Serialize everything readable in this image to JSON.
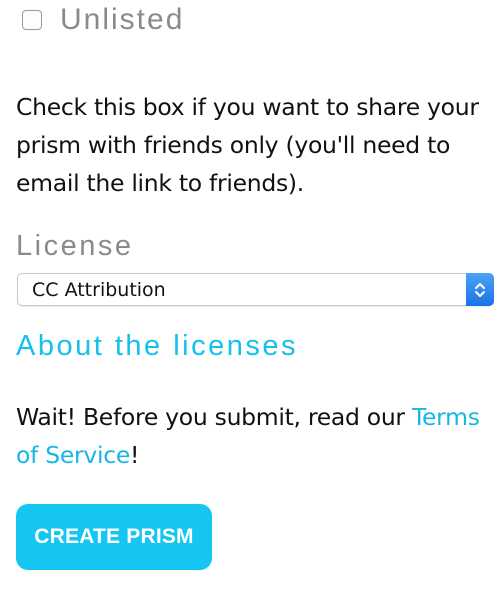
{
  "unlisted": {
    "label": "Unlisted",
    "checked": false
  },
  "help_text": "Check this box if you want to share your prism with friends only (you'll need to email the link to friends).",
  "license": {
    "label": "License",
    "selected": "CC Attribution"
  },
  "about_link": "About the licenses",
  "terms": {
    "prefix": "Wait! Before you submit, read our ",
    "link": "Terms of Service",
    "suffix": "!"
  },
  "submit_label": "CREATE PRISM",
  "colors": {
    "accent": "#16c0ec",
    "button": "#16c6f2",
    "muted_label": "#8a8a8a"
  }
}
